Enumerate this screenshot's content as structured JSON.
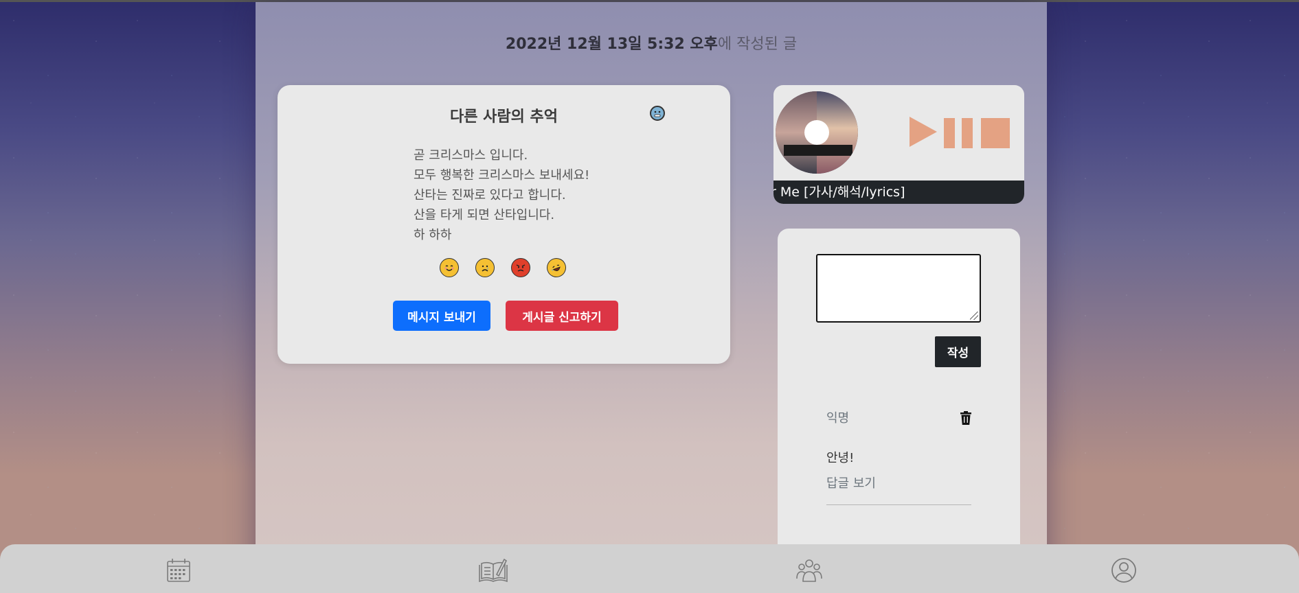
{
  "post": {
    "date_bold": "2022년 12월 13일 5:32 오후",
    "date_suffix": "에 작성된 글"
  },
  "memory": {
    "title": "다른 사람의 추억",
    "lines": [
      "곧 크리스마스 입니다.",
      "모두 행복한 크리스마스 보내세요!",
      "산타는 진짜로 있다고 합니다.",
      "산을 타게 되면 산타입니다.",
      "하 하하"
    ],
    "mood_icon": "cold-face-icon",
    "reactions": [
      "smile-icon",
      "sad-icon",
      "angry-icon",
      "laugh-icon"
    ],
    "send_message_label": "메시지 보내기",
    "report_label": "게시글 신고하기"
  },
  "player": {
    "song_title": "r Me [가사/해석/lyrics]",
    "controls": [
      "play-icon",
      "pause-icon",
      "stop-icon"
    ],
    "accent_color": "#e4a283"
  },
  "comments": {
    "input_placeholder": "",
    "submit_label": "작성",
    "items": [
      {
        "author": "익명",
        "text": "안녕!",
        "reply_label": "답글 보기"
      }
    ]
  },
  "nav": {
    "items": [
      "calendar-icon",
      "diary-icon",
      "friends-icon",
      "profile-icon"
    ]
  },
  "colors": {
    "primary": "#0d6efd",
    "danger": "#dc3545",
    "dark": "#212529"
  }
}
